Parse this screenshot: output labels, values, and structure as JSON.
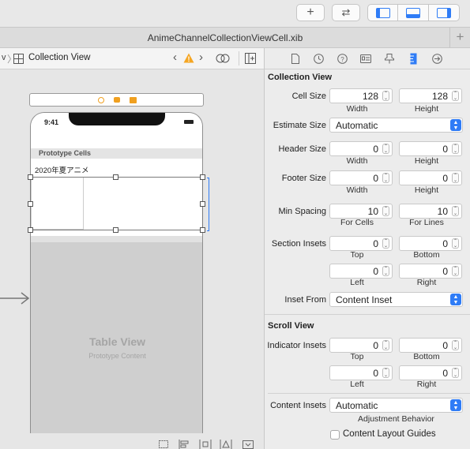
{
  "toolbar": {
    "add_label": "+",
    "swap_label": "⇄"
  },
  "tab": {
    "title": "AnimeChannelCollectionViewCell.xib",
    "plus": "+"
  },
  "jumpbar": {
    "prev": "v",
    "item": "Collection View"
  },
  "canvas": {
    "status_time": "9:41",
    "prototype_cells": "Prototype Cells",
    "cell_label": "2020年夏アニメ",
    "table_view_title": "Table View",
    "table_view_sub": "Prototype Content"
  },
  "inspector": {
    "collection_view": {
      "title": "Collection View",
      "cell_size": {
        "label": "Cell Size",
        "width": "128",
        "height": "128",
        "width_label": "Width",
        "height_label": "Height"
      },
      "estimate_size": {
        "label": "Estimate Size",
        "value": "Automatic"
      },
      "header_size": {
        "label": "Header Size",
        "width": "0",
        "height": "0",
        "width_label": "Width",
        "height_label": "Height"
      },
      "footer_size": {
        "label": "Footer Size",
        "width": "0",
        "height": "0",
        "width_label": "Width",
        "height_label": "Height"
      },
      "min_spacing": {
        "label": "Min Spacing",
        "cells": "10",
        "lines": "10",
        "cells_label": "For Cells",
        "lines_label": "For Lines"
      },
      "section_insets": {
        "label": "Section Insets",
        "top": "0",
        "bottom": "0",
        "left": "0",
        "right": "0",
        "top_label": "Top",
        "bottom_label": "Bottom",
        "left_label": "Left",
        "right_label": "Right"
      },
      "inset_from": {
        "label": "Inset From",
        "value": "Content Inset"
      }
    },
    "scroll_view": {
      "title": "Scroll View",
      "indicator_insets": {
        "label": "Indicator Insets",
        "top": "0",
        "bottom": "0",
        "left": "0",
        "right": "0",
        "top_label": "Top",
        "bottom_label": "Bottom",
        "left_label": "Left",
        "right_label": "Right"
      },
      "content_insets": {
        "label": "Content Insets",
        "value": "Automatic",
        "sub": "Adjustment Behavior"
      },
      "layout_guides": {
        "label": "Content Layout Guides",
        "checked": false
      }
    }
  },
  "colors": {
    "accent": "#2f7cf6",
    "warning": "#f5a623"
  }
}
